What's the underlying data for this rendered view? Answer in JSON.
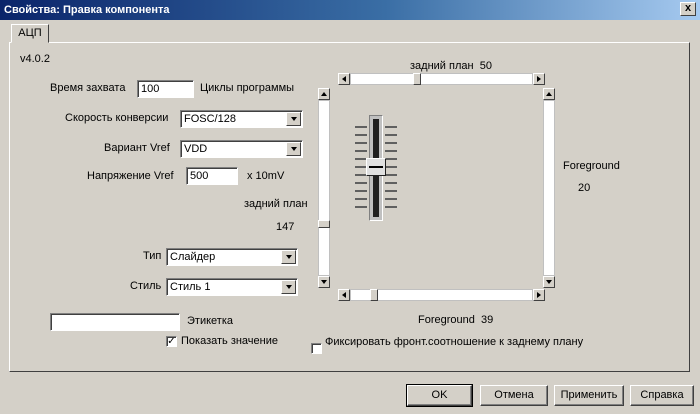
{
  "window": {
    "title": "Свойства: Правка компонента",
    "close_label": "x"
  },
  "tab": {
    "label": "АЦП"
  },
  "version": "v4.0.2",
  "capture": {
    "label": "Время захвата",
    "value": "100",
    "unit": "Циклы программы"
  },
  "conversion_speed": {
    "label": "Скорость конверсии",
    "value": "FOSC/128"
  },
  "vref_variant": {
    "label": "Вариант Vref",
    "value": "VDD"
  },
  "vref_voltage": {
    "label": "Напряжение Vref",
    "value": "500",
    "unit": "x 10mV"
  },
  "background_v": {
    "label": "задний план",
    "value": "147"
  },
  "type": {
    "label": "Тип",
    "value": "Слайдер"
  },
  "style": {
    "label": "Стиль",
    "value": "Стиль 1"
  },
  "caption": {
    "value": "",
    "label": "Этикетка"
  },
  "show_value": {
    "label": "Показать значение",
    "checked": true
  },
  "fix_ratio": {
    "label": "Фиксировать фронт.соотношение к заднему плану",
    "checked": false
  },
  "preview": {
    "background_top_label": "задний план",
    "background_top_value": "50",
    "foreground_right_label": "Foreground",
    "foreground_right_value": "20",
    "foreground_bottom_label": "Foreground",
    "foreground_bottom_value": "39"
  },
  "buttons": {
    "ok": "OK",
    "cancel": "Отмена",
    "apply": "Применить",
    "help": "Справка"
  }
}
